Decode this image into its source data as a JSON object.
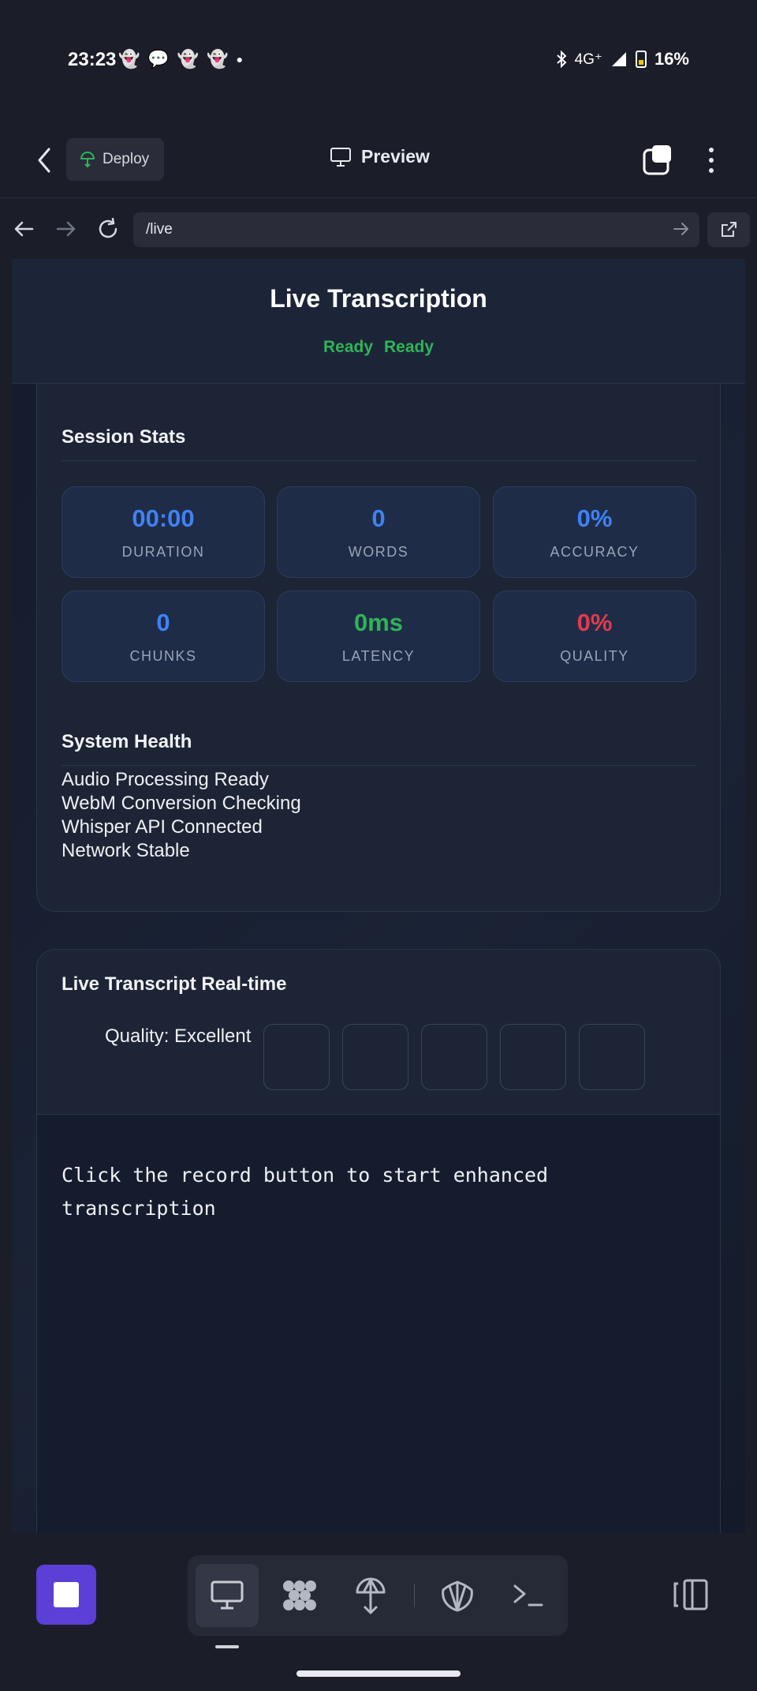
{
  "status_bar": {
    "time": "23:23",
    "network": "4G⁺",
    "battery": "16%",
    "notification_icons": [
      "snapchat-ghost-icon",
      "chat-bubble-icon",
      "snapchat-ghost-icon",
      "snapchat-ghost-icon",
      "dot-icon"
    ]
  },
  "app_header": {
    "deploy_label": "Deploy",
    "title": "Preview"
  },
  "browser": {
    "url": "/live"
  },
  "page": {
    "title": "Live Transcription",
    "status_left": "Ready",
    "status_right": "Ready",
    "stats_section_title": "Session Stats",
    "stats": [
      {
        "value": "00:00",
        "label": "DURATION",
        "color": "#3e82f5"
      },
      {
        "value": "0",
        "label": "WORDS",
        "color": "#3e82f5"
      },
      {
        "value": "0%",
        "label": "ACCURACY",
        "color": "#3e82f5"
      },
      {
        "value": "0",
        "label": "CHUNKS",
        "color": "#3e82f5"
      },
      {
        "value": "0ms",
        "label": "LATENCY",
        "color": "#2fb457"
      },
      {
        "value": "0%",
        "label": "QUALITY",
        "color": "#e23b4e"
      }
    ],
    "health_section_title": "System Health",
    "health_items": [
      "Audio Processing Ready",
      "WebM Conversion Checking",
      "Whisper API Connected",
      "Network Stable"
    ],
    "transcript_title": "Live Transcript Real-time",
    "quality_label": "Quality: Excellent",
    "transcript_placeholder": "Click the record button to start enhanced transcription"
  },
  "colors": {
    "accent_blue": "#3e82f5",
    "success_green": "#2fb457",
    "danger_red": "#e23b4e",
    "record_button": "#5b3fd6"
  }
}
